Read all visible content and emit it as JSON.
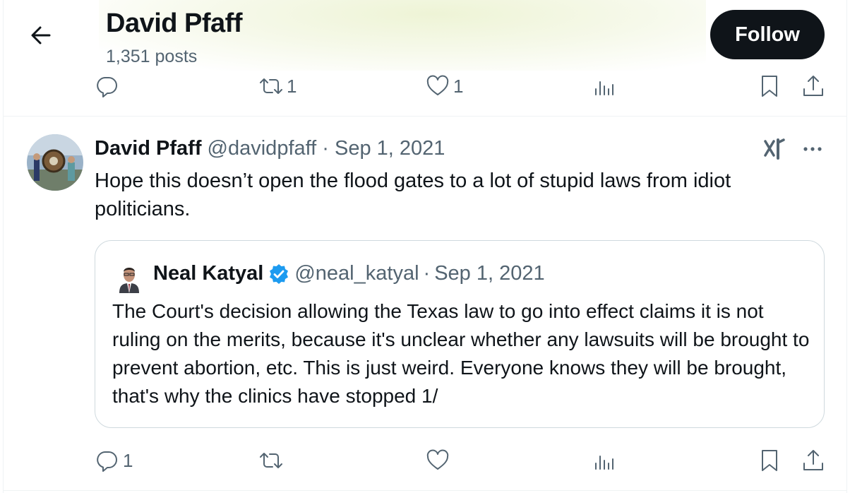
{
  "header": {
    "name": "David Pfaff",
    "post_count": "1,351 posts",
    "follow_label": "Follow"
  },
  "prev_post_actions": {
    "replies": "",
    "reposts": "1",
    "likes": "1"
  },
  "post": {
    "author_name": "David Pfaff",
    "handle": "@davidpfaff",
    "separator": "·",
    "date": "Sep 1, 2021",
    "text": "Hope this doesn’t open the flood gates to a lot of stupid laws from idiot politicians.",
    "quote": {
      "author_name": "Neal Katyal",
      "verified": true,
      "handle": "@neal_katyal",
      "separator": "·",
      "date": "Sep 1, 2021",
      "text": "The Court's decision allowing the Texas law to go into effect claims it is not ruling on the merits, because it's unclear whether any lawsuits will be brought to prevent abortion, etc. This is just weird. Everyone knows they will be brought, that's why the clinics have stopped 1/"
    },
    "actions": {
      "replies": "1",
      "reposts": "",
      "likes": ""
    }
  },
  "colors": {
    "text_primary": "#0f1419",
    "text_secondary": "#536471",
    "verified_blue": "#1d9bf0",
    "follow_bg": "#0f1419",
    "border": "#cfd9de"
  },
  "icons": [
    "back-arrow-icon",
    "reply-icon",
    "repost-icon",
    "like-icon",
    "views-icon",
    "bookmark-icon",
    "share-icon",
    "grok-icon",
    "more-icon",
    "verified-badge-icon"
  ]
}
